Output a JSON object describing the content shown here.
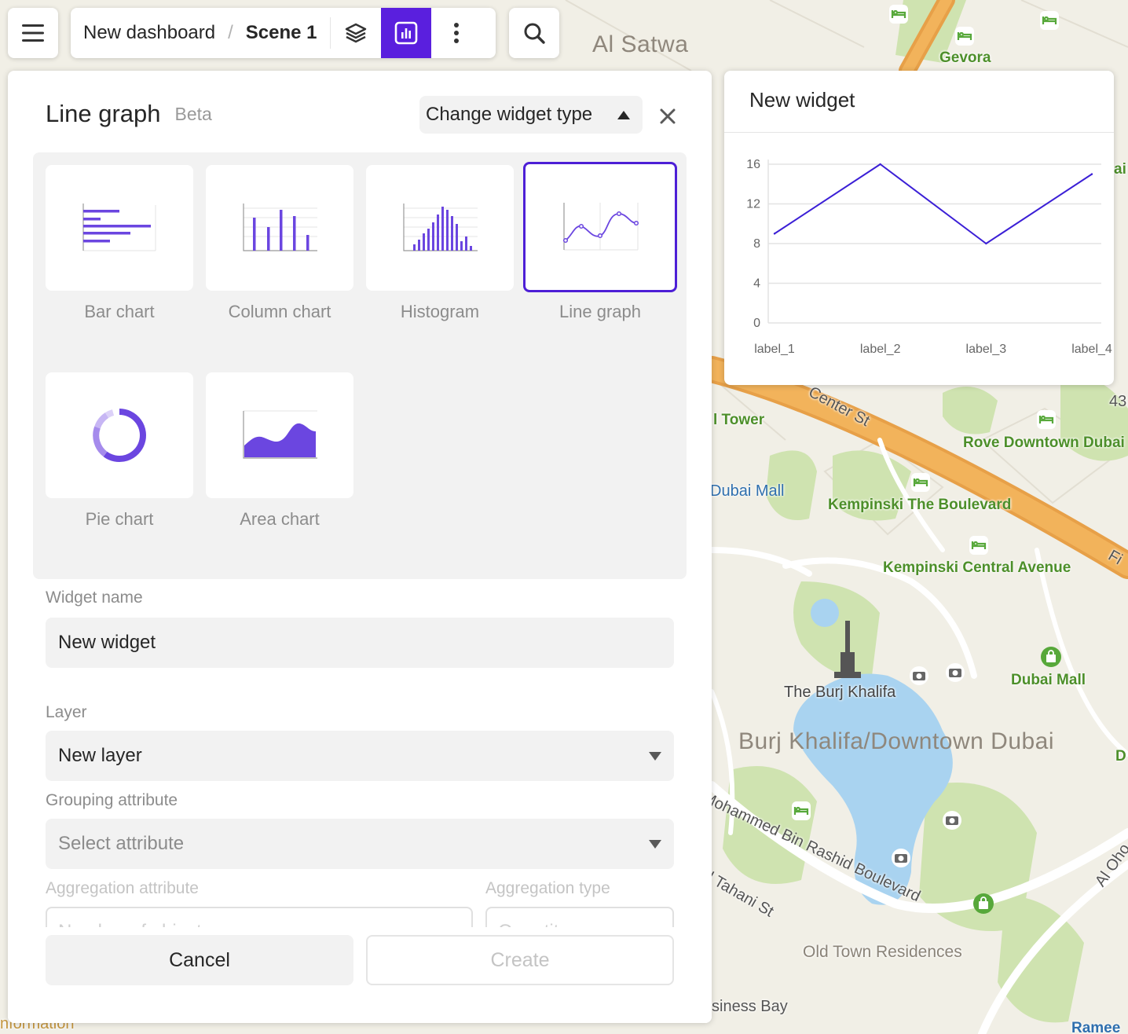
{
  "toolbar": {
    "dashboard_name": "New dashboard",
    "separator": "/",
    "scene_name": "Scene 1"
  },
  "panel": {
    "title": "Line graph",
    "badge": "Beta",
    "change_type_label": "Change widget type",
    "chart_types": [
      {
        "label": "Bar chart",
        "selected": false
      },
      {
        "label": "Column chart",
        "selected": false
      },
      {
        "label": "Histogram",
        "selected": false
      },
      {
        "label": "Line graph",
        "selected": true
      },
      {
        "label": "Pie chart",
        "selected": false
      },
      {
        "label": "Area chart",
        "selected": false
      }
    ],
    "widget_name_label": "Widget name",
    "widget_name_value": "New widget",
    "layer_label": "Layer",
    "layer_value": "New layer",
    "grouping_label": "Grouping attribute",
    "grouping_placeholder": "Select attribute",
    "aggregation_attr_label": "Aggregation attribute",
    "aggregation_attr_value": "Number of objects",
    "aggregation_type_label": "Aggregation type",
    "aggregation_type_value": "Quantity",
    "cancel_label": "Cancel",
    "create_label": "Create"
  },
  "widget": {
    "title": "New widget"
  },
  "chart_data": {
    "type": "line",
    "categories": [
      "label_1",
      "label_2",
      "label_3",
      "label_4"
    ],
    "series": [
      {
        "values": [
          9,
          16,
          8,
          15
        ]
      }
    ],
    "yticks": [
      0,
      4,
      8,
      12,
      16
    ],
    "ylim": [
      0,
      16
    ],
    "title": "",
    "xlabel": "",
    "ylabel": "",
    "grid": true,
    "line_color": "#3b1fd6"
  },
  "map": {
    "labels": {
      "al_satwa": "Al Satwa",
      "gevora": "Gevora",
      "center_st": "Center St",
      "tower": "l Tower",
      "rove": "Rove Downtown Dubai",
      "dubai_mall_w": "Dubai Mall",
      "kempinski_boulevard": "Kempinski The Boulevard",
      "kempinski_central": "Kempinski Central Avenue",
      "burj": "The Burj Khalifa",
      "dubai_mall": "Dubai Mall",
      "district": "Burj Khalifa/Downtown Dubai",
      "mbr_blvd": "Mohammed Bin Rashid Boulevard",
      "tahani": "l Tahani St",
      "old_town": "Old Town Residences",
      "business_bay": "siness Bay",
      "al_oho": "Al Oho",
      "ramee": "Ramee",
      "information": "nformation",
      "num_43": "43",
      "fi": "Fi",
      "ai": "ai",
      "d": "D"
    }
  },
  "colors": {
    "accent": "#5a1fde",
    "chart_icon": "#6b46e0",
    "map_bg": "#f1efe6",
    "park": "#cfe3b0",
    "water": "#a9d3f0",
    "highway": "#f2b35b"
  }
}
